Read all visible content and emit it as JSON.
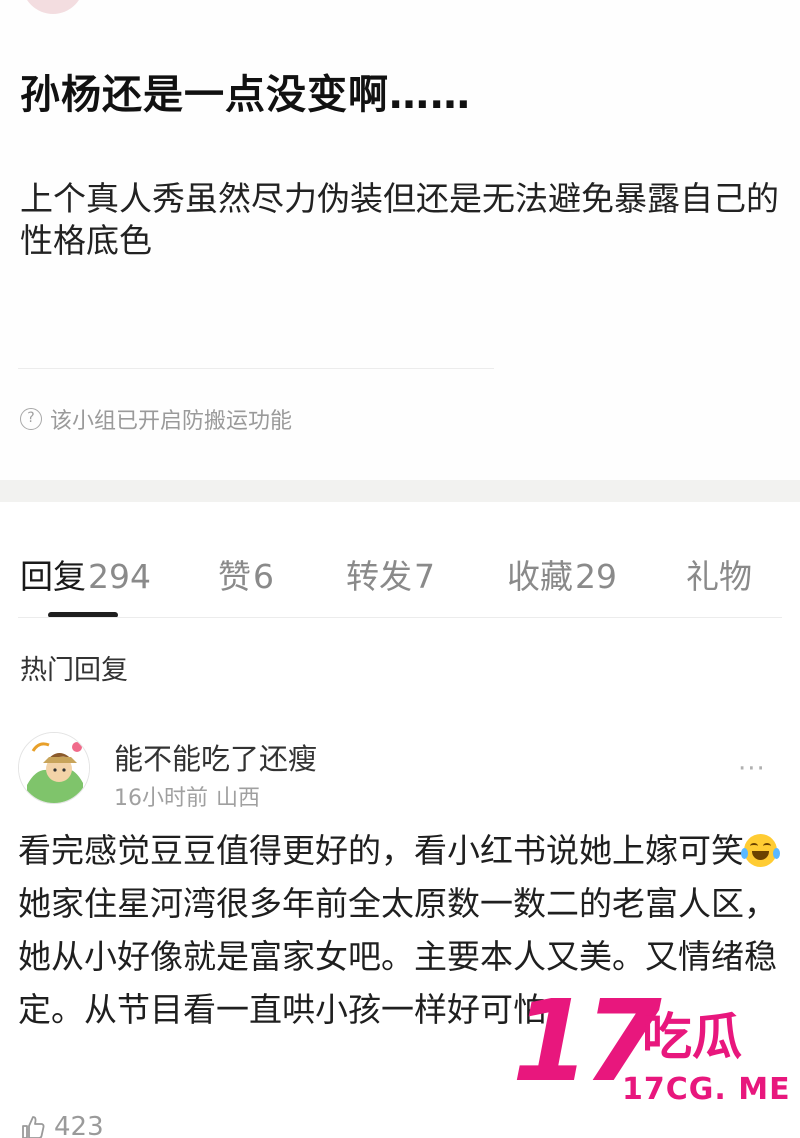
{
  "post": {
    "title": "孙杨还是一点没变啊……",
    "body": "上个真人秀虽然尽力伪装但还是无法避免暴露自己的性格底色",
    "notice": "该小组已开启防搬运功能",
    "notice_icon": "question-circle-icon"
  },
  "tabs": [
    {
      "label": "回复",
      "count": "294",
      "active": true
    },
    {
      "label": "赞",
      "count": "6",
      "active": false
    },
    {
      "label": "转发",
      "count": "7",
      "active": false
    },
    {
      "label": "收藏",
      "count": "29",
      "active": false
    },
    {
      "label": "礼物",
      "count": "",
      "active": false
    }
  ],
  "section_title": "热门回复",
  "comment": {
    "author": "能不能吃了还瘦",
    "time": "16小时前",
    "location": "山西",
    "more": "···",
    "text_before_emoji": "看完感觉豆豆值得更好的，看小红书说她上嫁可笑",
    "emoji": "joy-emoji",
    "text_after_emoji": "她家住星河湾很多年前全太原数一数二的老富人区，她从小好像就是富家女吧。主要本人又美。又情绪稳定。从节目看一直哄小孩一样好可怕",
    "likes": "423"
  },
  "watermark": {
    "number": "17",
    "text": "吃瓜",
    "url": "17CG. ME",
    "color": "#e8177d"
  }
}
